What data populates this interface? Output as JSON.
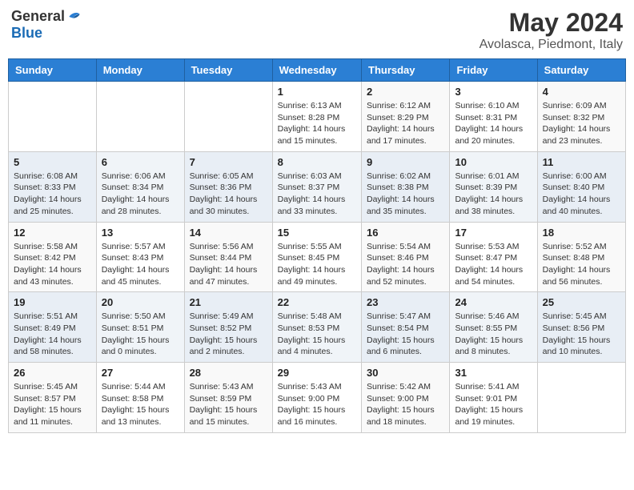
{
  "header": {
    "logo_general": "General",
    "logo_blue": "Blue",
    "month_title": "May 2024",
    "location": "Avolasca, Piedmont, Italy"
  },
  "weekdays": [
    "Sunday",
    "Monday",
    "Tuesday",
    "Wednesday",
    "Thursday",
    "Friday",
    "Saturday"
  ],
  "weeks": [
    [
      {
        "day": "",
        "info": ""
      },
      {
        "day": "",
        "info": ""
      },
      {
        "day": "",
        "info": ""
      },
      {
        "day": "1",
        "info": "Sunrise: 6:13 AM\nSunset: 8:28 PM\nDaylight: 14 hours\nand 15 minutes."
      },
      {
        "day": "2",
        "info": "Sunrise: 6:12 AM\nSunset: 8:29 PM\nDaylight: 14 hours\nand 17 minutes."
      },
      {
        "day": "3",
        "info": "Sunrise: 6:10 AM\nSunset: 8:31 PM\nDaylight: 14 hours\nand 20 minutes."
      },
      {
        "day": "4",
        "info": "Sunrise: 6:09 AM\nSunset: 8:32 PM\nDaylight: 14 hours\nand 23 minutes."
      }
    ],
    [
      {
        "day": "5",
        "info": "Sunrise: 6:08 AM\nSunset: 8:33 PM\nDaylight: 14 hours\nand 25 minutes."
      },
      {
        "day": "6",
        "info": "Sunrise: 6:06 AM\nSunset: 8:34 PM\nDaylight: 14 hours\nand 28 minutes."
      },
      {
        "day": "7",
        "info": "Sunrise: 6:05 AM\nSunset: 8:36 PM\nDaylight: 14 hours\nand 30 minutes."
      },
      {
        "day": "8",
        "info": "Sunrise: 6:03 AM\nSunset: 8:37 PM\nDaylight: 14 hours\nand 33 minutes."
      },
      {
        "day": "9",
        "info": "Sunrise: 6:02 AM\nSunset: 8:38 PM\nDaylight: 14 hours\nand 35 minutes."
      },
      {
        "day": "10",
        "info": "Sunrise: 6:01 AM\nSunset: 8:39 PM\nDaylight: 14 hours\nand 38 minutes."
      },
      {
        "day": "11",
        "info": "Sunrise: 6:00 AM\nSunset: 8:40 PM\nDaylight: 14 hours\nand 40 minutes."
      }
    ],
    [
      {
        "day": "12",
        "info": "Sunrise: 5:58 AM\nSunset: 8:42 PM\nDaylight: 14 hours\nand 43 minutes."
      },
      {
        "day": "13",
        "info": "Sunrise: 5:57 AM\nSunset: 8:43 PM\nDaylight: 14 hours\nand 45 minutes."
      },
      {
        "day": "14",
        "info": "Sunrise: 5:56 AM\nSunset: 8:44 PM\nDaylight: 14 hours\nand 47 minutes."
      },
      {
        "day": "15",
        "info": "Sunrise: 5:55 AM\nSunset: 8:45 PM\nDaylight: 14 hours\nand 49 minutes."
      },
      {
        "day": "16",
        "info": "Sunrise: 5:54 AM\nSunset: 8:46 PM\nDaylight: 14 hours\nand 52 minutes."
      },
      {
        "day": "17",
        "info": "Sunrise: 5:53 AM\nSunset: 8:47 PM\nDaylight: 14 hours\nand 54 minutes."
      },
      {
        "day": "18",
        "info": "Sunrise: 5:52 AM\nSunset: 8:48 PM\nDaylight: 14 hours\nand 56 minutes."
      }
    ],
    [
      {
        "day": "19",
        "info": "Sunrise: 5:51 AM\nSunset: 8:49 PM\nDaylight: 14 hours\nand 58 minutes."
      },
      {
        "day": "20",
        "info": "Sunrise: 5:50 AM\nSunset: 8:51 PM\nDaylight: 15 hours\nand 0 minutes."
      },
      {
        "day": "21",
        "info": "Sunrise: 5:49 AM\nSunset: 8:52 PM\nDaylight: 15 hours\nand 2 minutes."
      },
      {
        "day": "22",
        "info": "Sunrise: 5:48 AM\nSunset: 8:53 PM\nDaylight: 15 hours\nand 4 minutes."
      },
      {
        "day": "23",
        "info": "Sunrise: 5:47 AM\nSunset: 8:54 PM\nDaylight: 15 hours\nand 6 minutes."
      },
      {
        "day": "24",
        "info": "Sunrise: 5:46 AM\nSunset: 8:55 PM\nDaylight: 15 hours\nand 8 minutes."
      },
      {
        "day": "25",
        "info": "Sunrise: 5:45 AM\nSunset: 8:56 PM\nDaylight: 15 hours\nand 10 minutes."
      }
    ],
    [
      {
        "day": "26",
        "info": "Sunrise: 5:45 AM\nSunset: 8:57 PM\nDaylight: 15 hours\nand 11 minutes."
      },
      {
        "day": "27",
        "info": "Sunrise: 5:44 AM\nSunset: 8:58 PM\nDaylight: 15 hours\nand 13 minutes."
      },
      {
        "day": "28",
        "info": "Sunrise: 5:43 AM\nSunset: 8:59 PM\nDaylight: 15 hours\nand 15 minutes."
      },
      {
        "day": "29",
        "info": "Sunrise: 5:43 AM\nSunset: 9:00 PM\nDaylight: 15 hours\nand 16 minutes."
      },
      {
        "day": "30",
        "info": "Sunrise: 5:42 AM\nSunset: 9:00 PM\nDaylight: 15 hours\nand 18 minutes."
      },
      {
        "day": "31",
        "info": "Sunrise: 5:41 AM\nSunset: 9:01 PM\nDaylight: 15 hours\nand 19 minutes."
      },
      {
        "day": "",
        "info": ""
      }
    ]
  ]
}
